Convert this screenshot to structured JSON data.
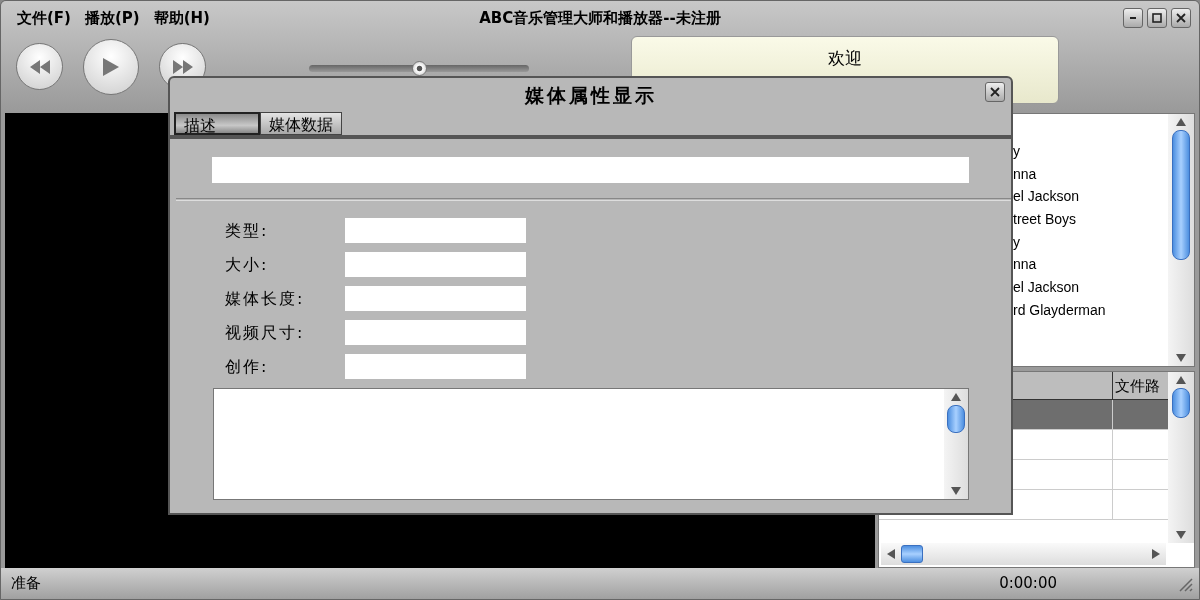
{
  "window": {
    "title": "ABC音乐管理大师和播放器--未注册"
  },
  "menu": [
    {
      "label": "文件(F)"
    },
    {
      "label": "播放(P)"
    },
    {
      "label": "帮助(H)"
    }
  ],
  "player": {
    "seek": {
      "level": 0.5
    },
    "welcome": "欢迎"
  },
  "playlist": {
    "items": [
      {
        "text": "y"
      },
      {
        "text": "nna"
      },
      {
        "text": "el Jackson"
      },
      {
        "text": "treet Boys"
      },
      {
        "text": "y"
      },
      {
        "text": "nna"
      },
      {
        "text": "el Jackson"
      },
      {
        "text": "rd Glayderman"
      }
    ]
  },
  "table": {
    "column_2": "文件路",
    "rows": [
      {
        "selected": true
      },
      {
        "selected": false
      },
      {
        "selected": false
      },
      {
        "selected": false
      }
    ]
  },
  "dialog": {
    "title": "媒体属性显示",
    "tabs": [
      {
        "label": "描述",
        "selected": true
      },
      {
        "label": "媒体数据",
        "selected": false
      }
    ],
    "fields": [
      {
        "label": "类型:"
      },
      {
        "label": "大小:"
      },
      {
        "label": "媒体长度:"
      },
      {
        "label": "视频尺寸:"
      },
      {
        "label": "创作:"
      }
    ]
  },
  "status_bar": {
    "text": "准备",
    "time": "0:00:00"
  }
}
